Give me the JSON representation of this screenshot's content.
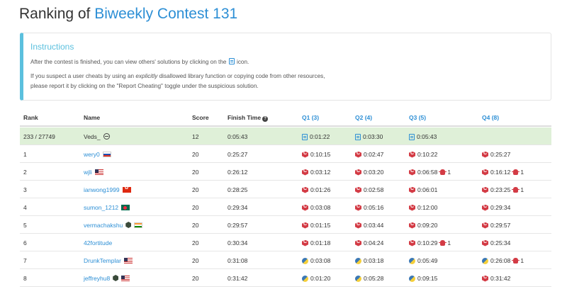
{
  "page": {
    "title_prefix": "Ranking of ",
    "title_contest": "Biweekly Contest 131"
  },
  "instructions": {
    "title": "Instructions",
    "line1_before": "After the contest is finished, you can view others' solutions by clicking on the ",
    "line1_after": " icon.",
    "line2_before": "If you suspect a user cheats by using an ",
    "line2_em": "explicitly",
    "line2_after": " disallowed library function or copying code from other resources,",
    "line3": "please report it by clicking on the \"Report Cheating\" toggle under the suspicious solution."
  },
  "table": {
    "headers": {
      "rank": "Rank",
      "name": "Name",
      "score": "Score",
      "finish_time": "Finish Time",
      "q1": "Q1 (3)",
      "q2": "Q2 (4)",
      "q3": "Q3 (5)",
      "q4": "Q4 (8)"
    },
    "help_glyph": "?",
    "rows": [
      {
        "rank": "233 / 27749",
        "name": "Veds_",
        "score": "12",
        "finish": "0:05:43",
        "q1": "0:01:22",
        "q2": "0:03:30",
        "q3": "0:05:43",
        "q4": "",
        "q3_bug": "",
        "q4_bug": ""
      },
      {
        "rank": "1",
        "name": "wery0",
        "score": "20",
        "finish": "0:25:27",
        "q1": "0:10:15",
        "q2": "0:02:47",
        "q3": "0:10:22",
        "q4": "0:25:27",
        "q3_bug": "",
        "q4_bug": ""
      },
      {
        "rank": "2",
        "name": "wjli",
        "score": "20",
        "finish": "0:26:12",
        "q1": "0:03:12",
        "q2": "0:03:20",
        "q3": "0:06:58",
        "q4": "0:16:12",
        "q3_bug": "1",
        "q4_bug": "1"
      },
      {
        "rank": "3",
        "name": "ianwong1999",
        "score": "20",
        "finish": "0:28:25",
        "q1": "0:01:26",
        "q2": "0:02:58",
        "q3": "0:06:01",
        "q4": "0:23:25",
        "q3_bug": "",
        "q4_bug": "1"
      },
      {
        "rank": "4",
        "name": "sumon_1212",
        "score": "20",
        "finish": "0:29:34",
        "q1": "0:03:08",
        "q2": "0:05:16",
        "q3": "0:12:00",
        "q4": "0:29:34",
        "q3_bug": "",
        "q4_bug": ""
      },
      {
        "rank": "5",
        "name": "vermachakshu",
        "score": "20",
        "finish": "0:29:57",
        "q1": "0:01:15",
        "q2": "0:03:44",
        "q3": "0:09:20",
        "q4": "0:29:57",
        "q3_bug": "",
        "q4_bug": ""
      },
      {
        "rank": "6",
        "name": "42fortitude",
        "score": "20",
        "finish": "0:30:34",
        "q1": "0:01:18",
        "q2": "0:04:24",
        "q3": "0:10:29",
        "q4": "0:25:34",
        "q3_bug": "1",
        "q4_bug": ""
      },
      {
        "rank": "7",
        "name": "DrunkTemplar",
        "score": "20",
        "finish": "0:31:08",
        "q1": "0:03:08",
        "q2": "0:03:18",
        "q3": "0:05:49",
        "q4": "0:26:08",
        "q3_bug": "",
        "q4_bug": "1"
      },
      {
        "rank": "8",
        "name": "jeffreyhu8",
        "score": "20",
        "finish": "0:31:42",
        "q1": "0:01:20",
        "q2": "0:05:28",
        "q3": "0:09:15",
        "q4": "0:31:42",
        "q3_bug": "",
        "q4_bug": ""
      }
    ]
  },
  "colors": {
    "accent": "#2d8fd5",
    "info_border": "#5bc0de",
    "my_row_bg": "#dff0d8",
    "bug_red": "#d33b45"
  },
  "icons": {
    "solution_doc": "doc-icon",
    "cpp": "cpp-icon",
    "python": "python-icon",
    "bug": "bug-icon",
    "help": "question-circle-icon"
  }
}
